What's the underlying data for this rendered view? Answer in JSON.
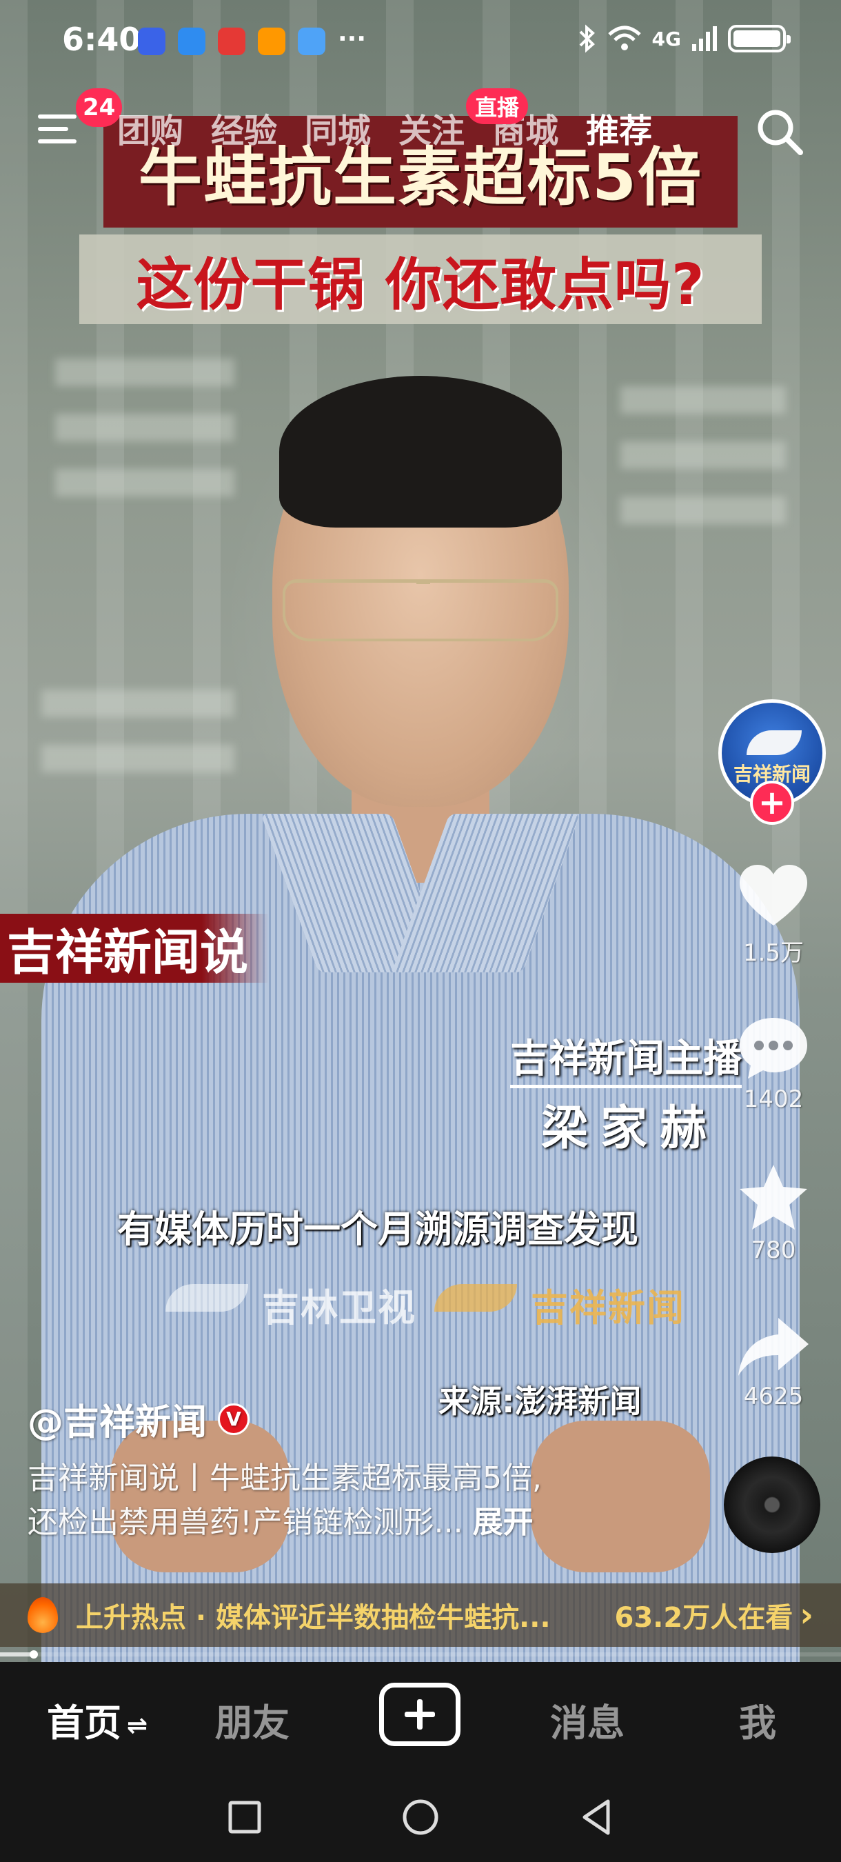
{
  "status_bar": {
    "time": "6:40",
    "more": "···",
    "network": "4G"
  },
  "top_nav": {
    "menu_badge": "24",
    "tabs": [
      {
        "label": "团购"
      },
      {
        "label": "经验"
      },
      {
        "label": "同城"
      },
      {
        "label": "关注"
      },
      {
        "label": "商城"
      },
      {
        "label": "推荐"
      }
    ],
    "live_badge": "直播"
  },
  "video_overlay": {
    "headline_1": "牛蛙抗生素超标5倍",
    "headline_2": "这份干锅 你还敢点吗?",
    "program_tag": "吉祥新闻说",
    "anchor_title": "吉祥新闻主播",
    "anchor_name": "梁家赫",
    "subtitle": "有媒体历时一个月溯源调查发现",
    "watermark_1": "吉林卫视",
    "watermark_2": "吉祥新闻",
    "source": "来源:澎湃新闻"
  },
  "right_rail": {
    "avatar_text": "吉祥新闻",
    "follow": "+",
    "likes": "1.5万",
    "comments": "1402",
    "favorites": "780",
    "shares": "4625"
  },
  "caption": {
    "author": "@吉祥新闻",
    "verified": "V",
    "line_1": "吉祥新闻说丨牛蛙抗生素超标最高5倍,",
    "line_2": "还检出禁用兽药!产销链检测形...",
    "expand": "展开"
  },
  "hot_bar": {
    "text": "上升热点 · 媒体评近半数抽检牛蛙抗...",
    "viewers": "63.2万人在看",
    "chevron": "›"
  },
  "playback": {
    "progress_fraction": 0.04
  },
  "bottom_nav": {
    "home": "首页",
    "home_swap": "⇌",
    "friends": "朋友",
    "messages": "消息",
    "me": "我"
  },
  "colors": {
    "accent": "#fe2c55",
    "hot_text": "#f5d36a",
    "headline_bg": "#7a1d22",
    "headline_red": "#c9151d"
  }
}
